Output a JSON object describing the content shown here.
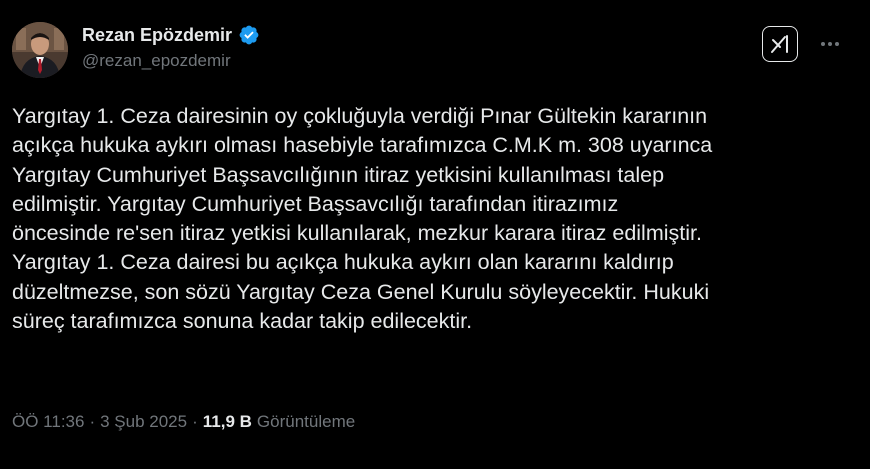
{
  "author": {
    "display_name": "Rezan Epözdemir",
    "handle": "@rezan_epozdemir"
  },
  "icons": {
    "verified": "verified-badge-icon",
    "grok": "grok-icon",
    "more": "more-options-icon"
  },
  "colors": {
    "background": "#000000",
    "text": "#e7e9ea",
    "secondary": "#71767b",
    "verified": "#1d9bf0"
  },
  "tweet": {
    "lines": [
      "Yargıtay 1. Ceza dairesinin oy çokluğuyla verdiği Pınar Gültekin kararının",
      "açıkça hukuka aykırı olması hasebiyle tarafımızca C.M.K m. 308 uyarınca",
      "Yargıtay Cumhuriyet Başsavcılığının itiraz yetkisini kullanılması talep",
      "edilmiştir. Yargıtay Cumhuriyet Başsavcılığı tarafından itirazımız",
      "öncesinde re'sen itiraz yetkisi kullanılarak, mezkur karara itiraz edilmiştir.",
      "Yargıtay 1. Ceza dairesi bu açıkça hukuka aykırı olan kararını kaldırıp",
      "düzeltmezse, son sözü Yargıtay Ceza Genel Kurulu söyleyecektir. Hukuki",
      "süreç tarafımızca sonuna kadar takip edilecektir."
    ]
  },
  "meta": {
    "time": "ÖÖ 11:36",
    "separator": "·",
    "date": "3 Şub 2025",
    "views_count": "11,9 B",
    "views_label": "Görüntüleme"
  }
}
